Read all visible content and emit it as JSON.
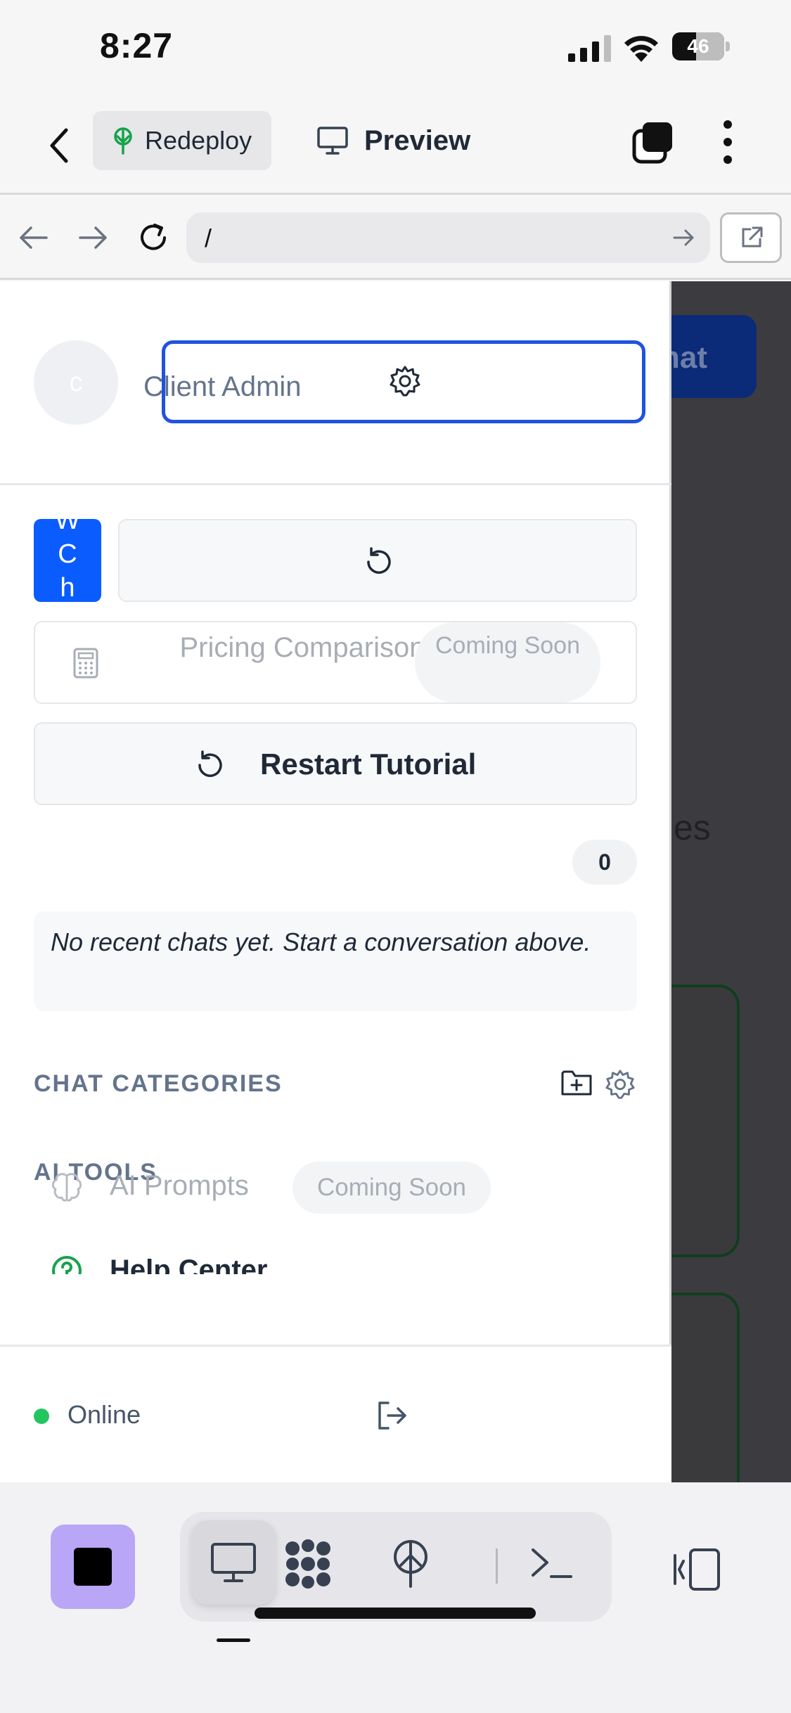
{
  "status_bar": {
    "time": "8:27",
    "battery": "46"
  },
  "app_bar": {
    "redeploy_label": "Redeploy",
    "preview_label": "Preview"
  },
  "url_bar": {
    "url": "/"
  },
  "background_page": {
    "button_fragment": "hat",
    "text_fragment": "es"
  },
  "drawer": {
    "profile": {
      "avatar_initial": "c",
      "name": "Client Admin"
    },
    "new_chat_fragment": "W\nC\nh",
    "pricing": {
      "label": "Pricing Comparison",
      "badge": "Coming Soon"
    },
    "tutorial_label": "Restart Tutorial",
    "recent_count": "0",
    "empty_message": "No recent chats yet. Start a conversation above.",
    "chat_categories_label": "CHAT CATEGORIES",
    "ai_tools_label": "AI TOOLS",
    "ai_prompts": {
      "label": "AI Prompts",
      "badge": "Coming Soon"
    },
    "help_center_label": "Help Center",
    "footer": {
      "status": "Online"
    }
  },
  "colors": {
    "accent": "#1f53e0",
    "brand_blue": "#0b5cff",
    "online": "#22c55e",
    "stop_button": "#b9a6f6"
  }
}
